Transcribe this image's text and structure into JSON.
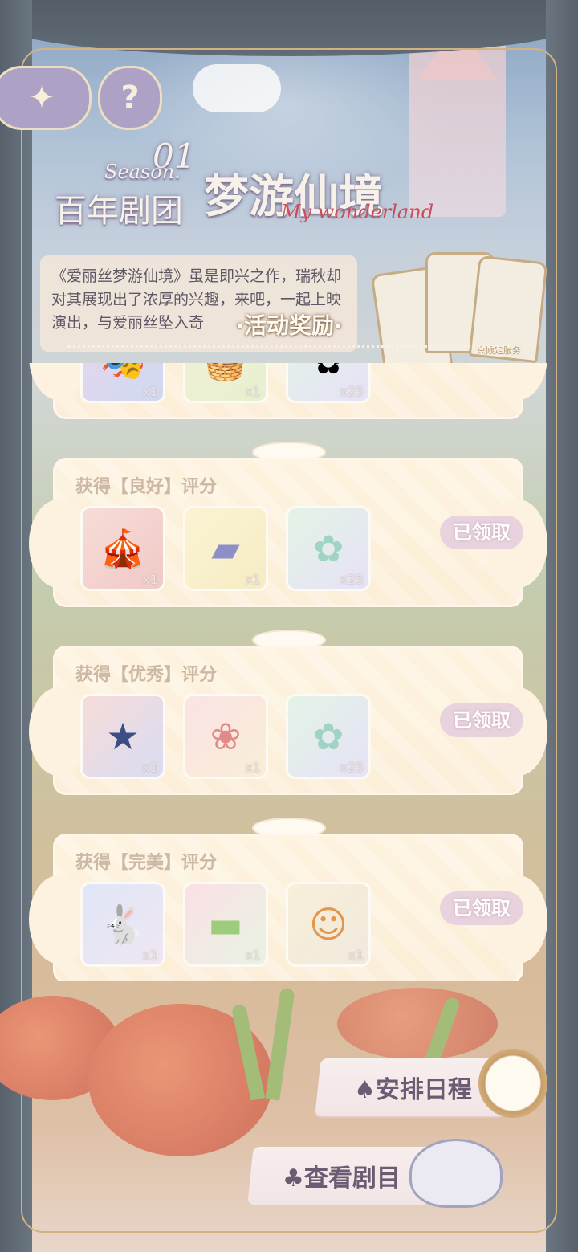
{
  "top_buttons": {
    "back_icon": "compass-star-icon",
    "help_label": "?"
  },
  "title": {
    "season_number": "01",
    "season_word": "Season.",
    "troupe": "百年剧团",
    "name": "梦游仙境",
    "english": "My wonderland"
  },
  "description": "《爱丽丝梦游仙境》虽是即兴之作，瑞秋却对其展现出了浓厚的兴趣，来吧，一起上映演出，与爱丽丝坠入奇",
  "tag_caption": "只限定服务",
  "panel": {
    "title": "·活动奖励·",
    "ornament": "~♡~"
  },
  "reward_rows": [
    {
      "title": "",
      "claimed_label": "",
      "items": [
        {
          "icon": "stage-scene-icon",
          "qty": "x1"
        },
        {
          "icon": "picnic-blanket-icon",
          "qty": "x1"
        },
        {
          "icon": "rainbow-star-icon",
          "qty": "x25"
        }
      ]
    },
    {
      "title": "获得【良好】评分",
      "claimed_label": "已领取",
      "items": [
        {
          "icon": "red-curtain-stage-icon",
          "qty": "x1"
        },
        {
          "icon": "flying-carpet-icon",
          "qty": "x1"
        },
        {
          "icon": "rainbow-star-icon",
          "qty": "x25"
        }
      ]
    },
    {
      "title": "获得【优秀】评分",
      "claimed_label": "已领取",
      "items": [
        {
          "icon": "night-stage-icon",
          "qty": "x1"
        },
        {
          "icon": "flower-frame-icon",
          "qty": "x1"
        },
        {
          "icon": "rainbow-star-icon",
          "qty": "x25"
        }
      ]
    },
    {
      "title": "获得【完美】评分",
      "claimed_label": "已领取",
      "items": [
        {
          "icon": "rabbit-painting-icon",
          "qty": "x1"
        },
        {
          "icon": "green-rug-icon",
          "qty": "x1"
        },
        {
          "icon": "character-avatar-icon",
          "qty": "x1"
        }
      ]
    }
  ],
  "actions": {
    "schedule": "♠安排日程",
    "view_play": "♣查看剧目"
  },
  "colors": {
    "card_bg": "#fdf2dc",
    "claimed_badge": "#e7d2dd",
    "frame_gold": "#c9a36a",
    "button_purple": "#9b8fbd"
  }
}
